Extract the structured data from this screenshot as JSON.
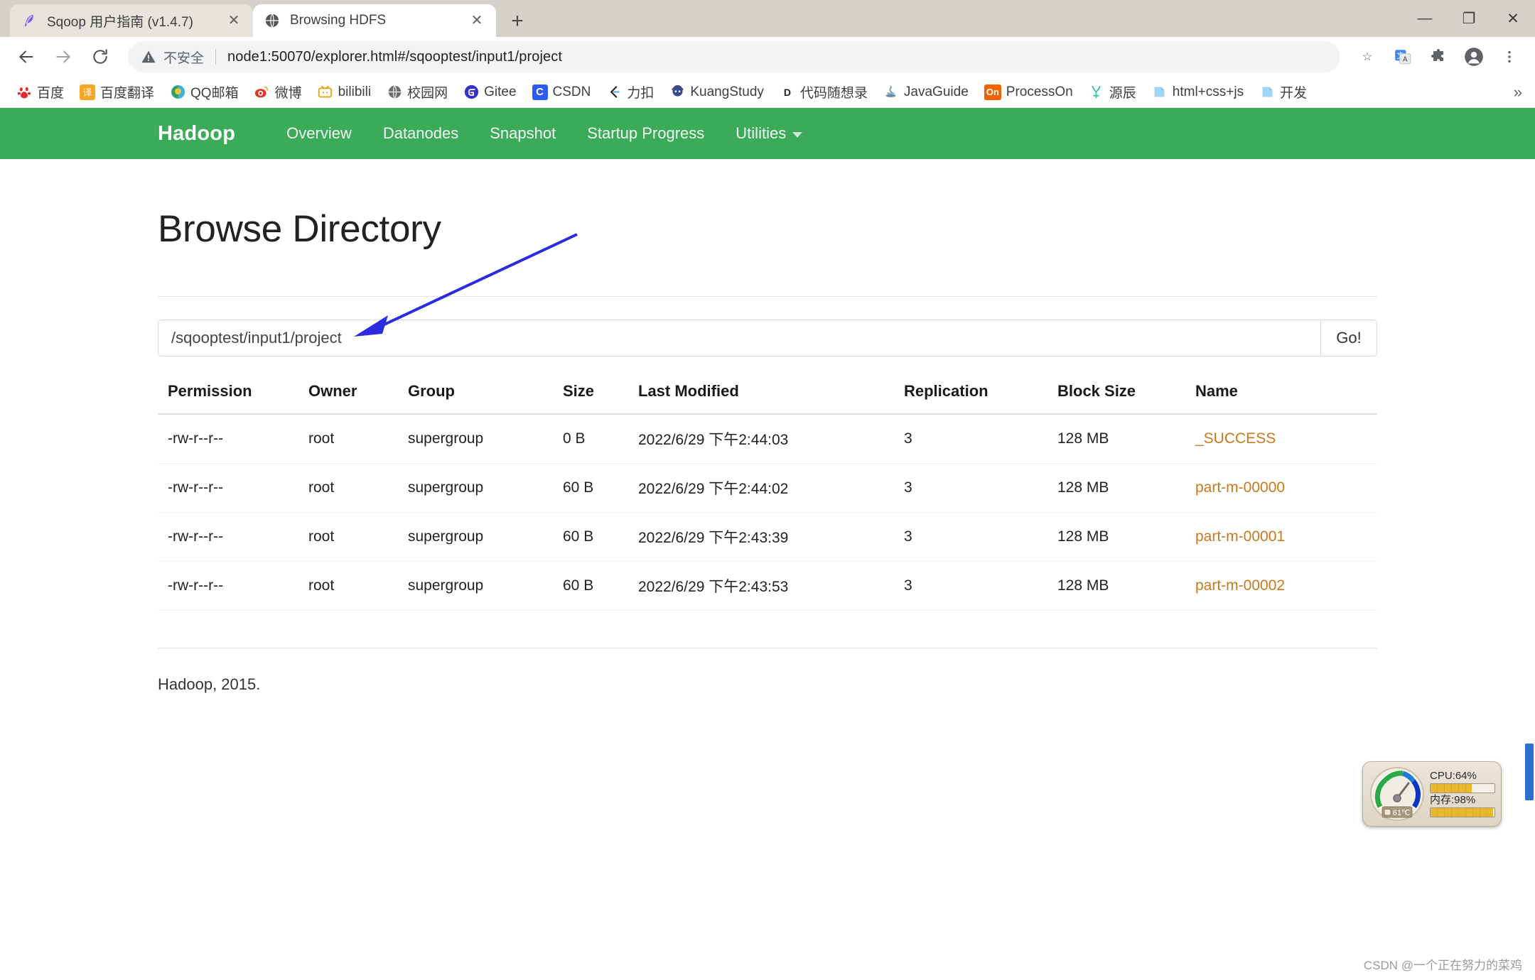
{
  "browser": {
    "tabs": [
      {
        "title": "Sqoop 用户指南 (v1.4.7)",
        "favicon": "feather-icon",
        "active": false,
        "close_label": "✕"
      },
      {
        "title": "Browsing HDFS",
        "favicon": "globe-icon",
        "active": true,
        "close_label": "✕"
      }
    ],
    "new_tab_label": "+",
    "window_controls": {
      "minimize": "—",
      "maximize": "❐",
      "close": "✕"
    },
    "nav": {
      "back": "←",
      "forward": "→",
      "reload": "⟳"
    },
    "omnibox": {
      "security_label": "不安全",
      "url": "node1:50070/explorer.html#/sqooptest/input1/project",
      "host": "node1:50070",
      "path": "/explorer.html#/sqooptest/input1/project",
      "star_label": "☆"
    },
    "toolbar_icons": [
      "translate-icon",
      "extensions-icon",
      "profile-icon",
      "menu-icon"
    ],
    "bookmarks": [
      {
        "label": "百度",
        "icon": "baidu-icon"
      },
      {
        "label": "百度翻译",
        "icon": "baidu-translate-icon"
      },
      {
        "label": "QQ邮箱",
        "icon": "qqmail-icon"
      },
      {
        "label": "微博",
        "icon": "weibo-icon"
      },
      {
        "label": "bilibili",
        "icon": "bilibili-icon"
      },
      {
        "label": "校园网",
        "icon": "globe-icon"
      },
      {
        "label": "Gitee",
        "icon": "gitee-icon"
      },
      {
        "label": "CSDN",
        "icon": "csdn-icon"
      },
      {
        "label": "力扣",
        "icon": "leetcode-icon"
      },
      {
        "label": "KuangStudy",
        "icon": "kuangstudy-icon"
      },
      {
        "label": "代码随想录",
        "icon": "daima-icon"
      },
      {
        "label": "JavaGuide",
        "icon": "javaguide-icon"
      },
      {
        "label": "ProcessOn",
        "icon": "processon-icon"
      },
      {
        "label": "源辰",
        "icon": "yuanchen-icon"
      },
      {
        "label": "html+css+js",
        "icon": "folder-icon"
      },
      {
        "label": "开发",
        "icon": "folder-icon"
      }
    ],
    "bookmarks_overflow": "»"
  },
  "hadoop": {
    "brand": "Hadoop",
    "navlinks": [
      {
        "label": "Overview",
        "has_caret": false
      },
      {
        "label": "Datanodes",
        "has_caret": false
      },
      {
        "label": "Snapshot",
        "has_caret": false
      },
      {
        "label": "Startup Progress",
        "has_caret": false
      },
      {
        "label": "Utilities",
        "has_caret": true
      }
    ],
    "page_title": "Browse Directory",
    "path_value": "/sqooptest/input1/project",
    "go_label": "Go!",
    "table": {
      "headers": [
        "Permission",
        "Owner",
        "Group",
        "Size",
        "Last Modified",
        "Replication",
        "Block Size",
        "Name"
      ],
      "rows": [
        {
          "permission": "-rw-r--r--",
          "owner": "root",
          "group": "supergroup",
          "size": "0 B",
          "modified": "2022/6/29 下午2:44:03",
          "replication": "3",
          "block_size": "128 MB",
          "name": "_SUCCESS"
        },
        {
          "permission": "-rw-r--r--",
          "owner": "root",
          "group": "supergroup",
          "size": "60 B",
          "modified": "2022/6/29 下午2:44:02",
          "replication": "3",
          "block_size": "128 MB",
          "name": "part-m-00000"
        },
        {
          "permission": "-rw-r--r--",
          "owner": "root",
          "group": "supergroup",
          "size": "60 B",
          "modified": "2022/6/29 下午2:43:39",
          "replication": "3",
          "block_size": "128 MB",
          "name": "part-m-00001"
        },
        {
          "permission": "-rw-r--r--",
          "owner": "root",
          "group": "supergroup",
          "size": "60 B",
          "modified": "2022/6/29 下午2:43:53",
          "replication": "3",
          "block_size": "128 MB",
          "name": "part-m-00002"
        }
      ]
    },
    "footer": "Hadoop, 2015."
  },
  "overlay": {
    "cpu_label": "CPU:64%",
    "mem_label": "内存:98%",
    "temp_label": "61℃",
    "cpu_percent": 64,
    "mem_percent": 98,
    "watermark": "CSDN @一个正在努力的菜鸡"
  },
  "colors": {
    "hadoop_green": "#3bab5a",
    "file_link": "#c8791c",
    "annotation_arrow": "#2b2be0",
    "tabstrip": "#d6d0cb"
  }
}
